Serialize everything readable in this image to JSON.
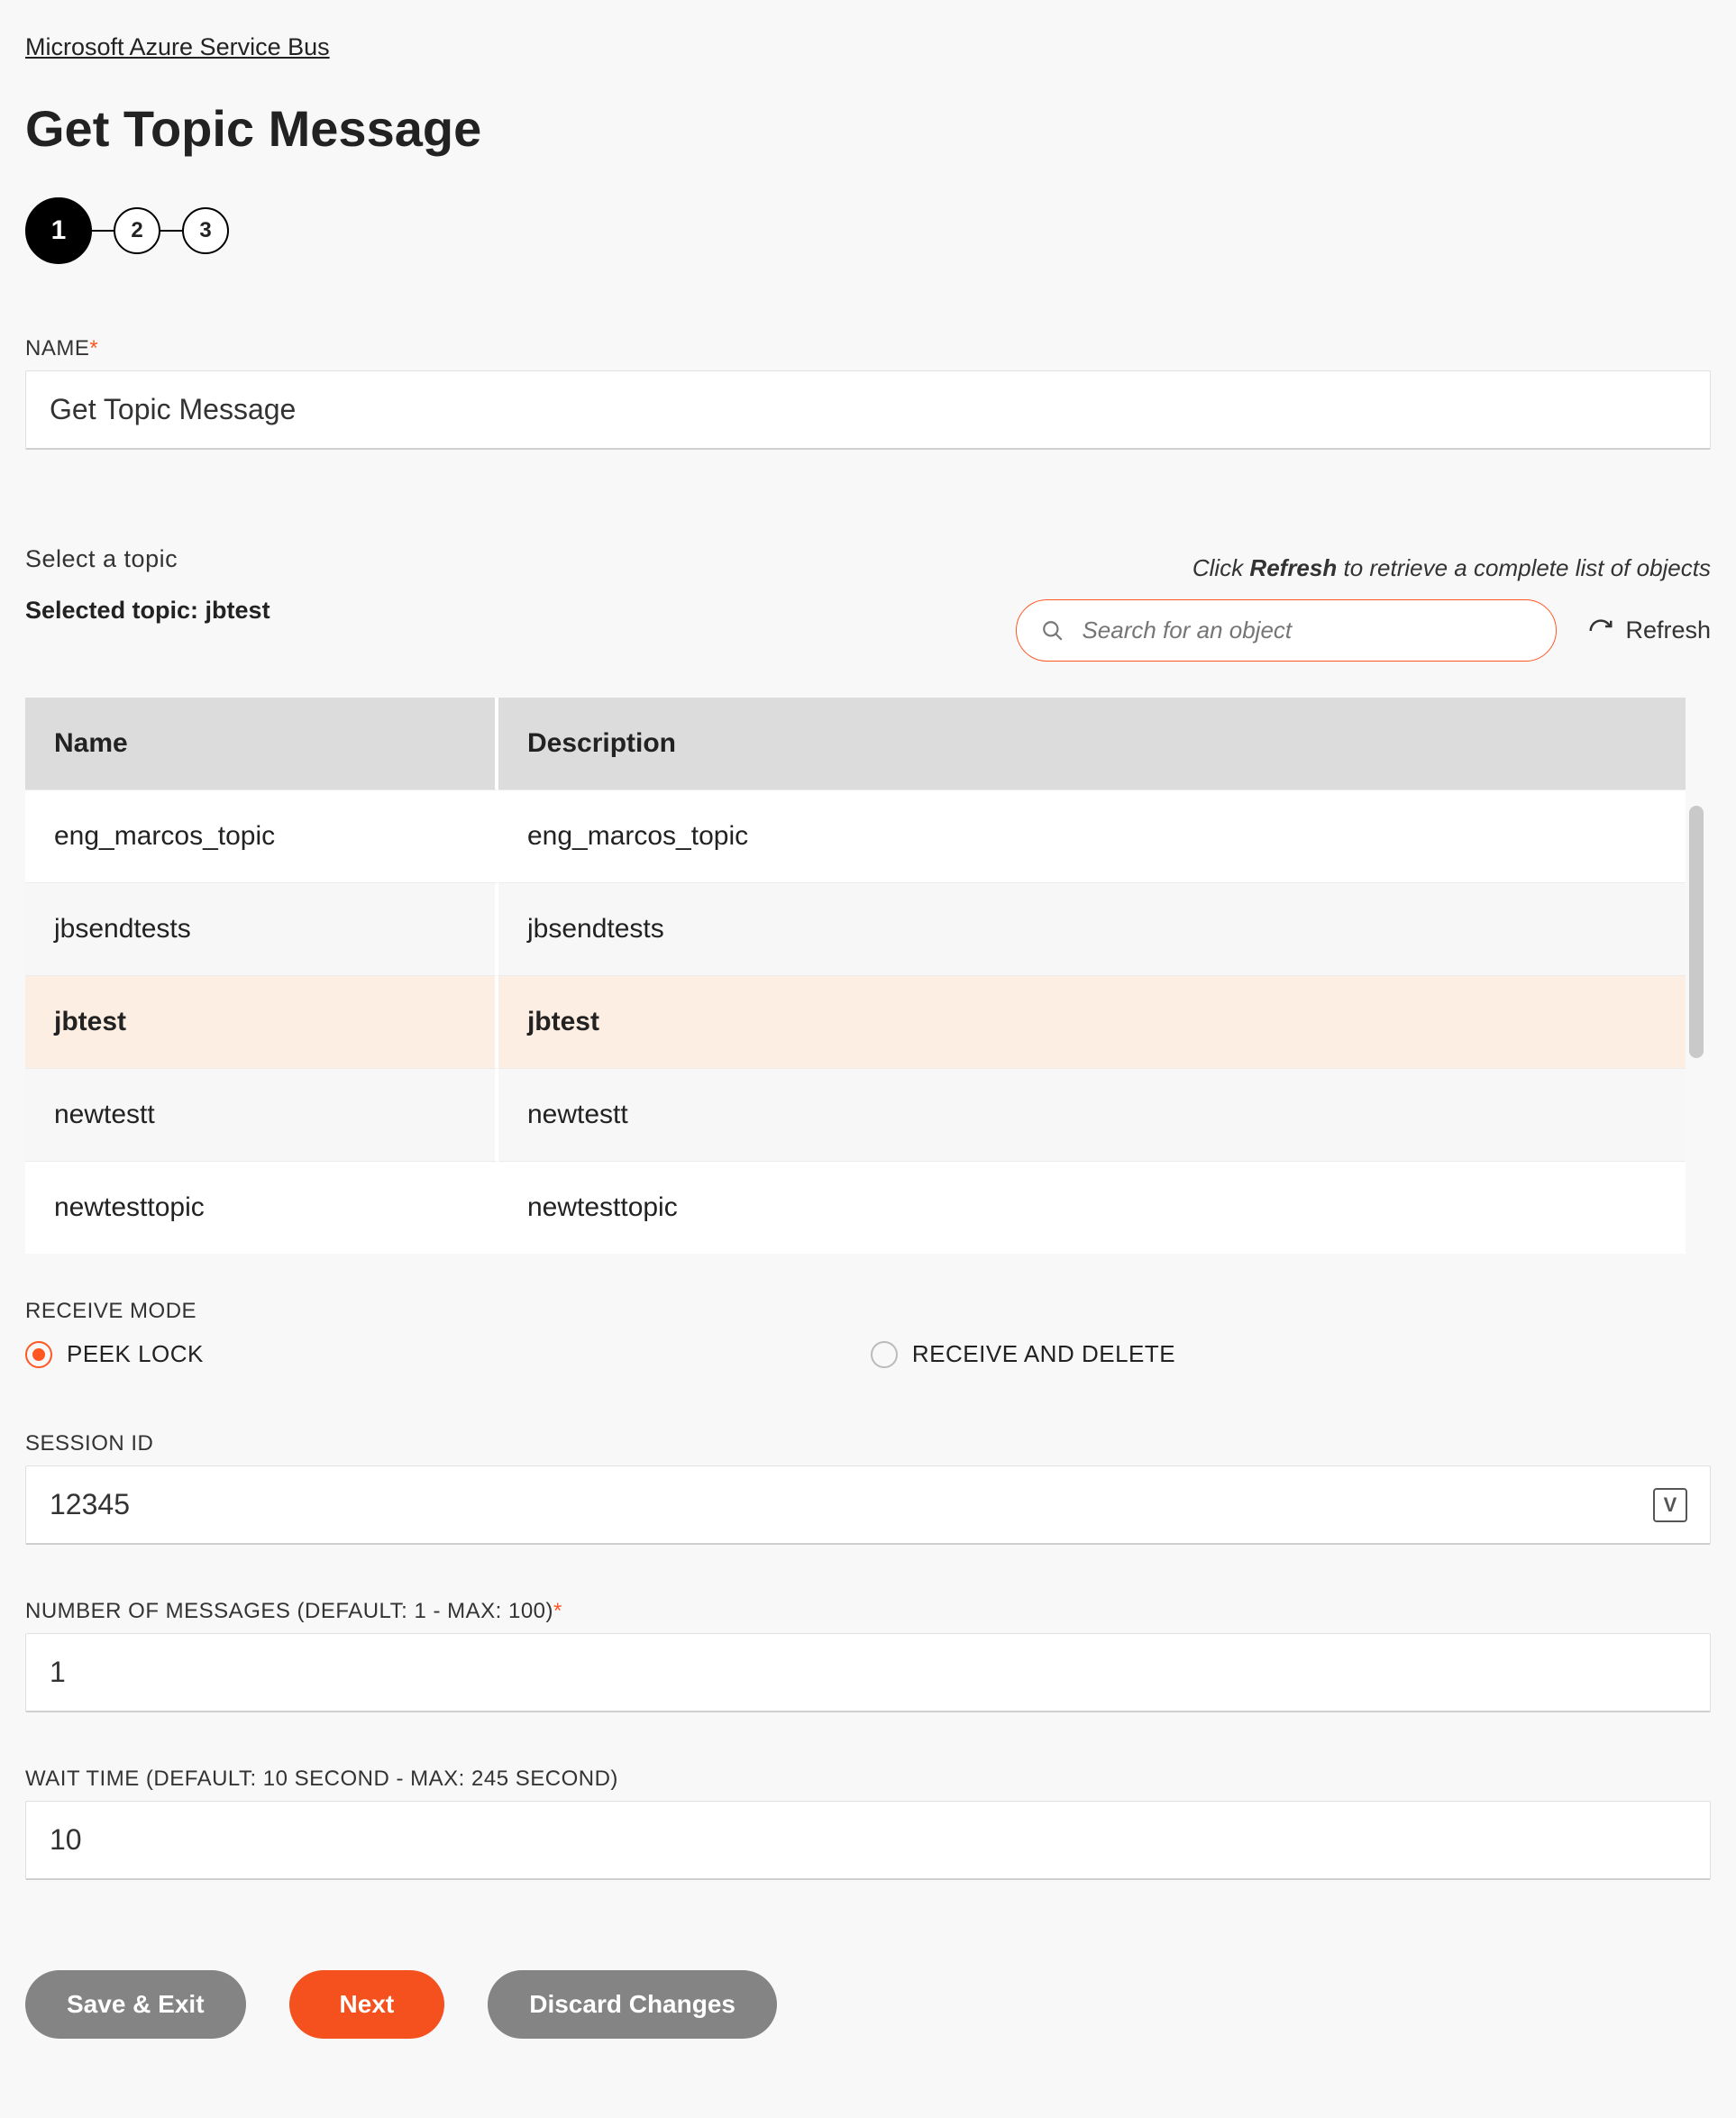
{
  "breadcrumb": "Microsoft Azure Service Bus",
  "page_title": "Get Topic Message",
  "stepper": {
    "steps": [
      "1",
      "2",
      "3"
    ],
    "active_index": 0
  },
  "name_field": {
    "label": "NAME",
    "required": true,
    "value": "Get Topic Message"
  },
  "topic_section": {
    "prompt": "Select a topic",
    "hint_prefix": "Click ",
    "hint_bold": "Refresh",
    "hint_suffix": " to retrieve a complete list of objects",
    "selected_label_prefix": "Selected topic: ",
    "selected_value": "jbtest",
    "search_placeholder": "Search for an object",
    "refresh_label": "Refresh",
    "columns": [
      "Name",
      "Description"
    ],
    "rows": [
      {
        "name": "eng_marcos_topic",
        "description": "eng_marcos_topic",
        "selected": false
      },
      {
        "name": "jbsendtests",
        "description": "jbsendtests",
        "selected": false
      },
      {
        "name": "jbtest",
        "description": "jbtest",
        "selected": true
      },
      {
        "name": "newtestt",
        "description": "newtestt",
        "selected": false
      },
      {
        "name": "newtesttopic",
        "description": "newtesttopic",
        "selected": false
      }
    ]
  },
  "receive_mode": {
    "label": "RECEIVE MODE",
    "options": [
      "PEEK LOCK",
      "RECEIVE AND DELETE"
    ],
    "selected_index": 0
  },
  "session_id": {
    "label": "SESSION ID",
    "value": "12345",
    "icon_letter": "V"
  },
  "num_messages": {
    "label": "NUMBER OF MESSAGES (DEFAULT: 1 - MAX: 100)",
    "required": true,
    "value": "1"
  },
  "wait_time": {
    "label": "WAIT TIME (DEFAULT: 10 SECOND - MAX: 245 SECOND)",
    "value": "10"
  },
  "buttons": {
    "save_exit": "Save & Exit",
    "next": "Next",
    "discard": "Discard Changes"
  }
}
